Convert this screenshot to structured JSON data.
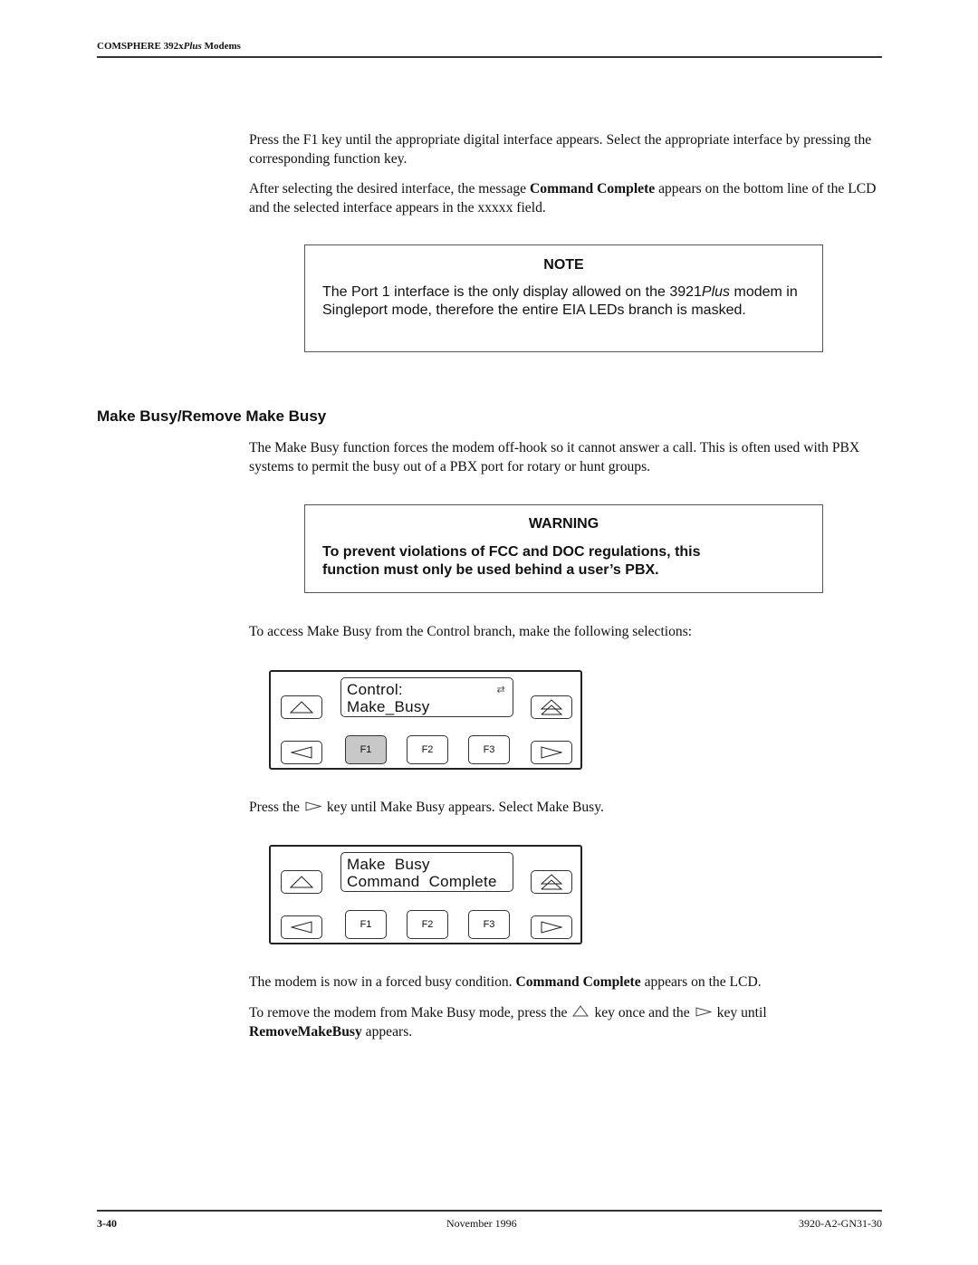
{
  "header": {
    "running_head_prefix": "COMSPHERE 392x",
    "running_head_italic": "Plus",
    "running_head_suffix": " Modems"
  },
  "intro": {
    "para1": "Press the F1 key until the appropriate digital interface appears. Select the appropriate interface by pressing the corresponding function key.",
    "para2_before": "After selecting the desired interface, the message ",
    "para2_bold": "Command Complete",
    "para2_after": " appears on the bottom line of the LCD and the selected interface appears in the xxxxx field."
  },
  "note": {
    "title": "NOTE",
    "body_before": "The Port 1 interface is the only display allowed on the 3921",
    "body_italic": "Plus",
    "body_after": " modem in Singleport mode, therefore the entire EIA LEDs branch is masked."
  },
  "section": {
    "heading": "Make Busy/Remove Make Busy",
    "para": "The Make Busy function forces the modem off-hook so it cannot answer a call. This is often used with PBX systems to permit the busy out of a PBX port for rotary or hunt groups."
  },
  "warning": {
    "title": "WARNING",
    "body": "To prevent violations of FCC and DOC regulations, this function must only be used behind a user’s PBX."
  },
  "access_para": "To access Make Busy from the Control branch, make the following selections:",
  "keypad1": {
    "lcd_line1": "Control:",
    "lcd_line2": "Make_Busy",
    "lcd_icon": "⇄",
    "f1": "F1",
    "f2": "F2",
    "f3": "F3",
    "pressed_key": "F1"
  },
  "press_para": {
    "before": "Press the",
    "after": "key until Make Busy appears. Select Make Busy."
  },
  "keypad2": {
    "lcd_line1": "Make  Busy",
    "lcd_line2": "Command  Complete",
    "f1": "F1",
    "f2": "F2",
    "f3": "F3"
  },
  "result_para": {
    "before": "The modem is now in a forced busy condition. ",
    "bold": "Command Complete",
    "after": " appears on the LCD."
  },
  "remove_para": {
    "part1": "To remove the modem from Make Busy mode, press the",
    "part2": "key once and the",
    "part3": "key until",
    "bold": "RemoveMakeBusy",
    "part4": " appears."
  },
  "footer": {
    "page_number": "3-40",
    "date": "November 1996",
    "doc_id": "3920-A2-GN31-30"
  }
}
